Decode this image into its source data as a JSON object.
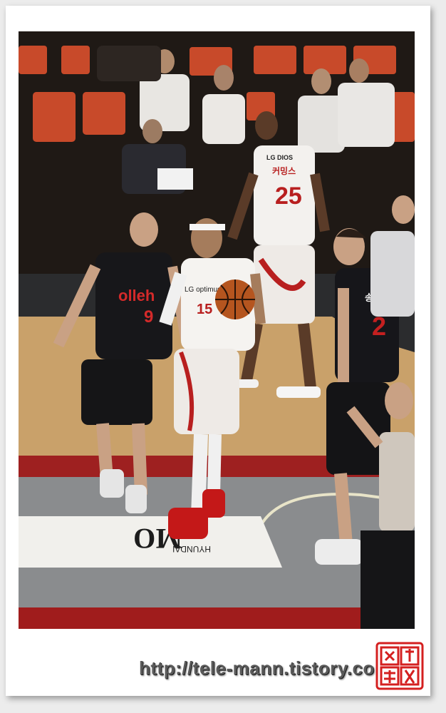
{
  "photo": {
    "sponsor_text": "olleh",
    "dios_text": "LG DIOS",
    "opti_text": "LG optimus",
    "court_logo": "HYUNDAI",
    "court_letters": "MO",
    "players": [
      {
        "team": "olleh",
        "number": "9"
      },
      {
        "team": "LG",
        "number": "15"
      },
      {
        "team": "LG",
        "number": "25",
        "name_kr": "커밍스"
      },
      {
        "team": "olleh",
        "number": "2",
        "name_kr": "송영진"
      }
    ]
  },
  "watermark": {
    "url": "http://tele-mann.tistory.com"
  },
  "seal": {
    "icon": "red-name-seal-icon",
    "color": "#d42020"
  }
}
